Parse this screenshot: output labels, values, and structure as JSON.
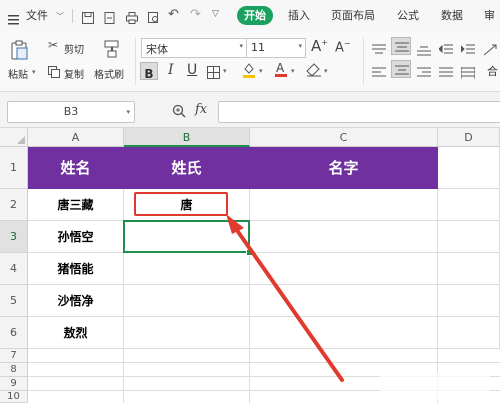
{
  "menu": {
    "file_label": "文件",
    "tabs": [
      "开始",
      "插入",
      "页面布局",
      "公式",
      "数据",
      "审"
    ]
  },
  "ribbon": {
    "paste": "粘贴",
    "cut": "剪切",
    "copy": "复制",
    "format_painter": "格式刷",
    "font_name": "宋体",
    "font_size": "11",
    "grow_font": "A",
    "shrink_font": "A",
    "bold": "B",
    "italic": "I",
    "underline": "U",
    "merge_partial": "合"
  },
  "formula_bar": {
    "name_box": "B3",
    "fx": "fx",
    "formula": ""
  },
  "columns": [
    "A",
    "B",
    "C",
    "D"
  ],
  "rows": [
    "1",
    "2",
    "3",
    "4",
    "5",
    "6",
    "7",
    "8",
    "9",
    "10"
  ],
  "header_row": [
    "姓名",
    "姓氏",
    "名字"
  ],
  "data_rows": [
    {
      "name": "唐三藏",
      "surname": "唐",
      "given": ""
    },
    {
      "name": "孙悟空",
      "surname": "",
      "given": ""
    },
    {
      "name": "猪悟能",
      "surname": "",
      "given": ""
    },
    {
      "name": "沙悟净",
      "surname": "",
      "given": ""
    },
    {
      "name": "敖烈",
      "surname": "",
      "given": ""
    }
  ],
  "colors": {
    "header_fill": "#7030a0",
    "active_tab": "#1aa160",
    "selection": "#1e8f4c",
    "annotation": "#e03a2f"
  },
  "selected_cell": "B3"
}
